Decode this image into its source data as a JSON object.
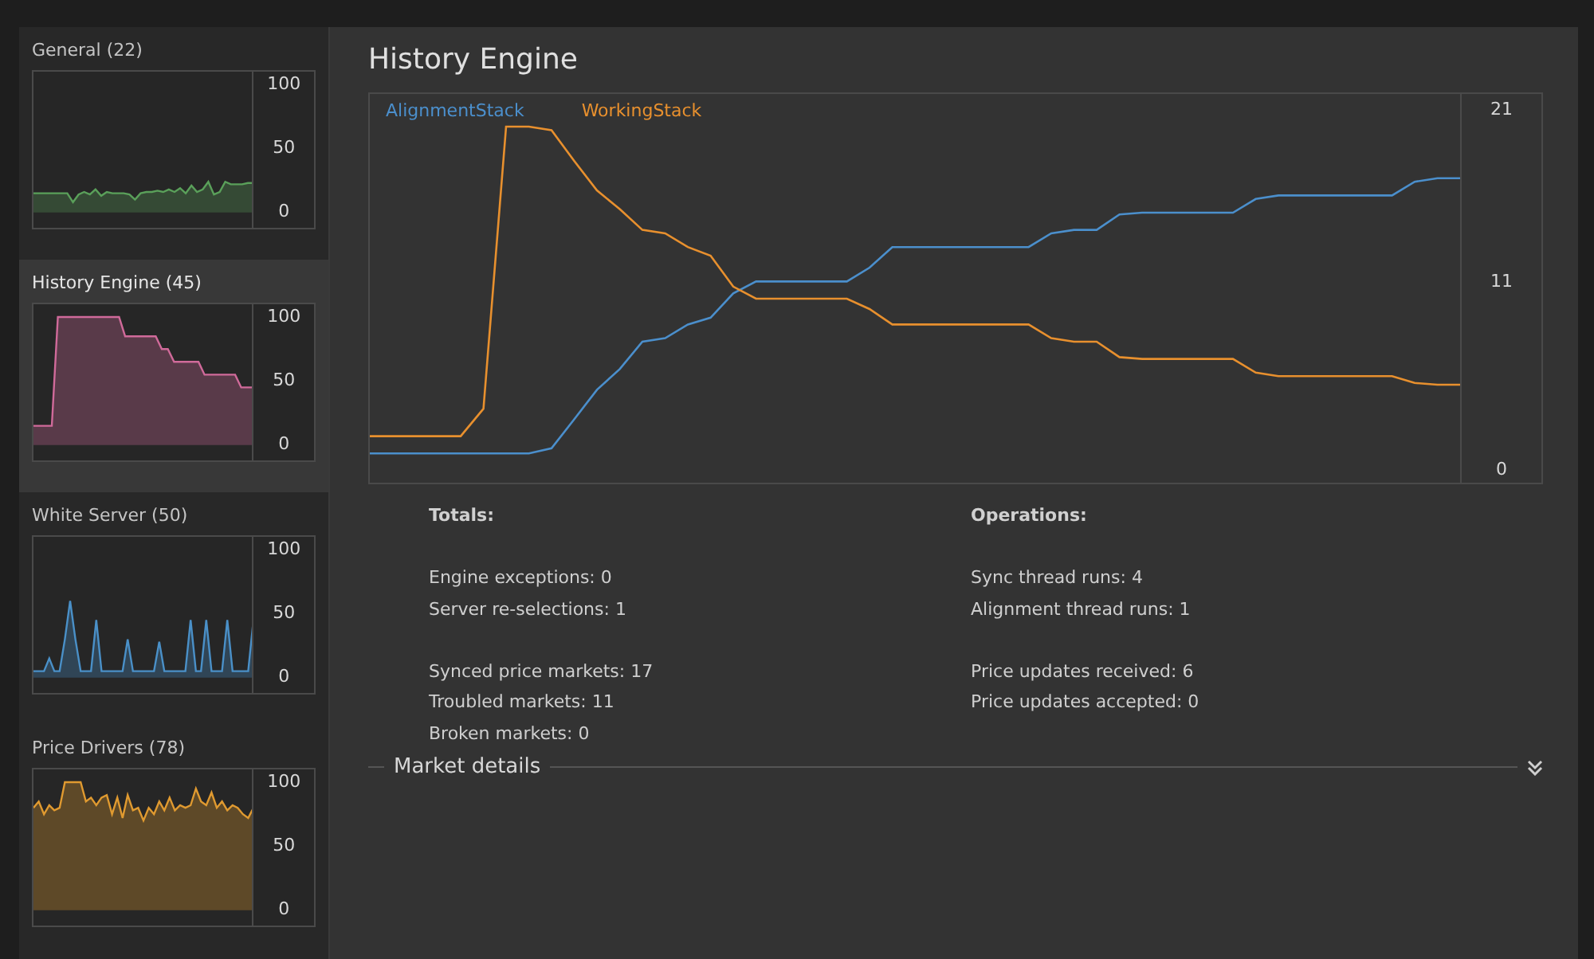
{
  "sidebar": {
    "items": [
      {
        "title": "General (22)",
        "selected": false,
        "chart_data": {
          "type": "area",
          "yticks": [
            0,
            50,
            100
          ],
          "ylim": [
            -12,
            110
          ],
          "series": [
            {
              "color": "#5aa05a",
              "values": [
                15,
                15,
                15,
                15,
                15,
                15,
                15,
                8,
                14,
                16,
                14,
                18,
                13,
                16,
                15,
                15,
                15,
                14,
                10,
                15,
                16,
                16,
                17,
                16,
                18,
                16,
                19,
                15,
                21,
                16,
                18,
                24,
                14,
                16,
                24,
                22,
                22,
                22,
                23,
                23
              ]
            }
          ]
        }
      },
      {
        "title": "History Engine (45)",
        "selected": true,
        "chart_data": {
          "type": "area",
          "yticks": [
            0,
            50,
            100
          ],
          "ylim": [
            -12,
            110
          ],
          "series": [
            {
              "color": "#d06a9a",
              "values": [
                15,
                15,
                15,
                15,
                100,
                100,
                100,
                100,
                100,
                100,
                100,
                100,
                100,
                100,
                100,
                85,
                85,
                85,
                85,
                85,
                85,
                75,
                75,
                65,
                65,
                65,
                65,
                65,
                55,
                55,
                55,
                55,
                55,
                55,
                45,
                45,
                45
              ]
            }
          ]
        }
      },
      {
        "title": "White Server (50)",
        "selected": false,
        "chart_data": {
          "type": "area",
          "yticks": [
            0,
            50,
            100
          ],
          "ylim": [
            -12,
            110
          ],
          "series": [
            {
              "color": "#4a90c8",
              "values": [
                5,
                5,
                5,
                15,
                5,
                5,
                30,
                60,
                30,
                5,
                5,
                5,
                45,
                5,
                5,
                5,
                5,
                5,
                30,
                5,
                5,
                5,
                5,
                5,
                28,
                5,
                5,
                5,
                5,
                5,
                45,
                5,
                5,
                45,
                5,
                5,
                5,
                45,
                5,
                5,
                5,
                5,
                45
              ]
            }
          ]
        }
      },
      {
        "title": "Price Drivers (78)",
        "selected": false,
        "chart_data": {
          "type": "area",
          "yticks": [
            0,
            50,
            100
          ],
          "ylim": [
            -12,
            110
          ],
          "series": [
            {
              "color": "#e09a30",
              "values": [
                80,
                85,
                75,
                82,
                78,
                80,
                100,
                100,
                100,
                100,
                85,
                88,
                82,
                88,
                90,
                75,
                88,
                72,
                90,
                78,
                80,
                70,
                80,
                75,
                85,
                78,
                88,
                78,
                82,
                80,
                82,
                95,
                85,
                82,
                92,
                80,
                85,
                78,
                82,
                80,
                75,
                72,
                80
              ]
            }
          ]
        }
      }
    ]
  },
  "main": {
    "title": "History Engine",
    "chart_data": {
      "type": "line",
      "ylim": [
        -0.7,
        21.9
      ],
      "yticks": [
        0,
        11,
        21
      ],
      "series": [
        {
          "name": "AlignmentStack",
          "color": "#4b8fcc",
          "values": [
            1,
            1,
            1,
            1,
            1,
            1,
            1,
            1,
            1.3,
            3,
            4.7,
            5.9,
            7.5,
            7.7,
            8.5,
            8.9,
            10.3,
            11,
            11,
            11,
            11,
            11,
            11.8,
            13,
            13,
            13,
            13,
            13,
            13,
            13,
            13.8,
            14,
            14,
            14.9,
            15,
            15,
            15,
            15,
            15,
            15.8,
            16,
            16,
            16,
            16,
            16,
            16,
            16.8,
            17,
            17
          ]
        },
        {
          "name": "WorkingStack",
          "color": "#e8902e",
          "values": [
            2,
            2,
            2,
            2,
            2,
            3.6,
            20,
            20,
            19.8,
            18,
            16.3,
            15.2,
            14,
            13.8,
            13,
            12.5,
            10.7,
            10,
            10,
            10,
            10,
            10,
            9.4,
            8.5,
            8.5,
            8.5,
            8.5,
            8.5,
            8.5,
            8.5,
            7.7,
            7.5,
            7.5,
            6.6,
            6.5,
            6.5,
            6.5,
            6.5,
            6.5,
            5.7,
            5.5,
            5.5,
            5.5,
            5.5,
            5.5,
            5.5,
            5.1,
            5,
            5
          ]
        }
      ]
    },
    "stats": [
      {
        "heading": "Totals:",
        "groups": [
          [
            "Engine exceptions: 0",
            "Server re-selections: 1"
          ],
          [
            "Synced price markets: 17",
            "Troubled markets: 11",
            "Broken markets: 0"
          ]
        ]
      },
      {
        "heading": "Operations:",
        "groups": [
          [
            "Sync thread runs: 4",
            "Alignment thread runs: 1"
          ],
          [
            "Price updates received: 6",
            "Price updates accepted: 0"
          ]
        ]
      }
    ],
    "section": {
      "label": "Market details",
      "expanded": false
    }
  }
}
